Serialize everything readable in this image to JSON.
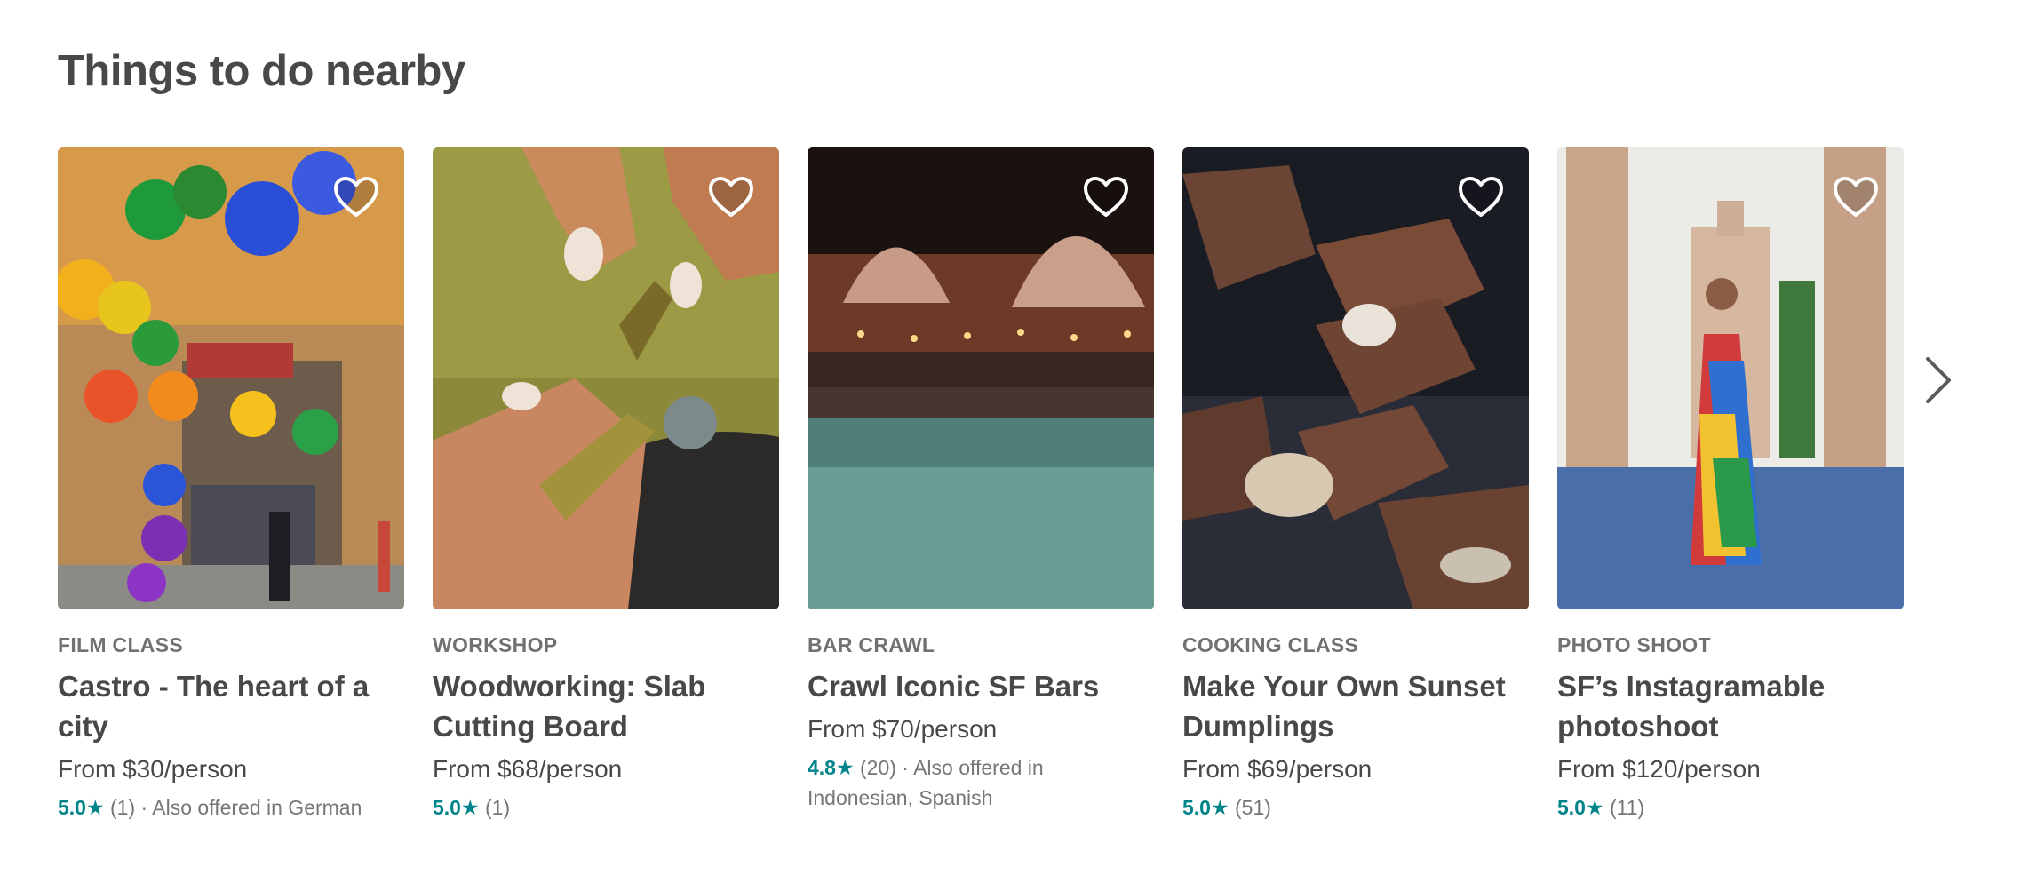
{
  "section": {
    "title": "Things to do nearby"
  },
  "cards": [
    {
      "category": "FILM CLASS",
      "title": "Castro - The heart of a city",
      "price": "From $30/person",
      "score": "5.0",
      "reviews": "(1)",
      "extra": "· Also offered in German",
      "image_icon": "castro-street-photo"
    },
    {
      "category": "WORKSHOP",
      "title": "Woodworking: Slab Cutting Board",
      "price": "From $68/person",
      "score": "5.0",
      "reviews": "(1)",
      "extra": "",
      "image_icon": "woodworking-photo"
    },
    {
      "category": "BAR CRAWL",
      "title": "Crawl Iconic SF Bars",
      "price": "From $70/person",
      "score": "4.8",
      "reviews": "(20)",
      "extra": "· Also offered in Indonesian, Spanish",
      "image_icon": "tiki-bar-photo"
    },
    {
      "category": "COOKING CLASS",
      "title": "Make Your Own Sunset Dumplings",
      "price": "From $69/person",
      "score": "5.0",
      "reviews": "(51)",
      "extra": "",
      "image_icon": "dumplings-photo"
    },
    {
      "category": "PHOTO SHOOT",
      "title": "SF’s Instagramable photoshoot",
      "price": "From $120/person",
      "score": "5.0",
      "reviews": "(11)",
      "extra": "",
      "image_icon": "palace-photoshoot-photo"
    }
  ],
  "star_glyph": "★",
  "icons": {
    "favorite": "heart-icon",
    "next": "chevron-right-icon"
  },
  "colors": {
    "accent": "#008489",
    "text": "#484848",
    "muted": "#717171"
  }
}
